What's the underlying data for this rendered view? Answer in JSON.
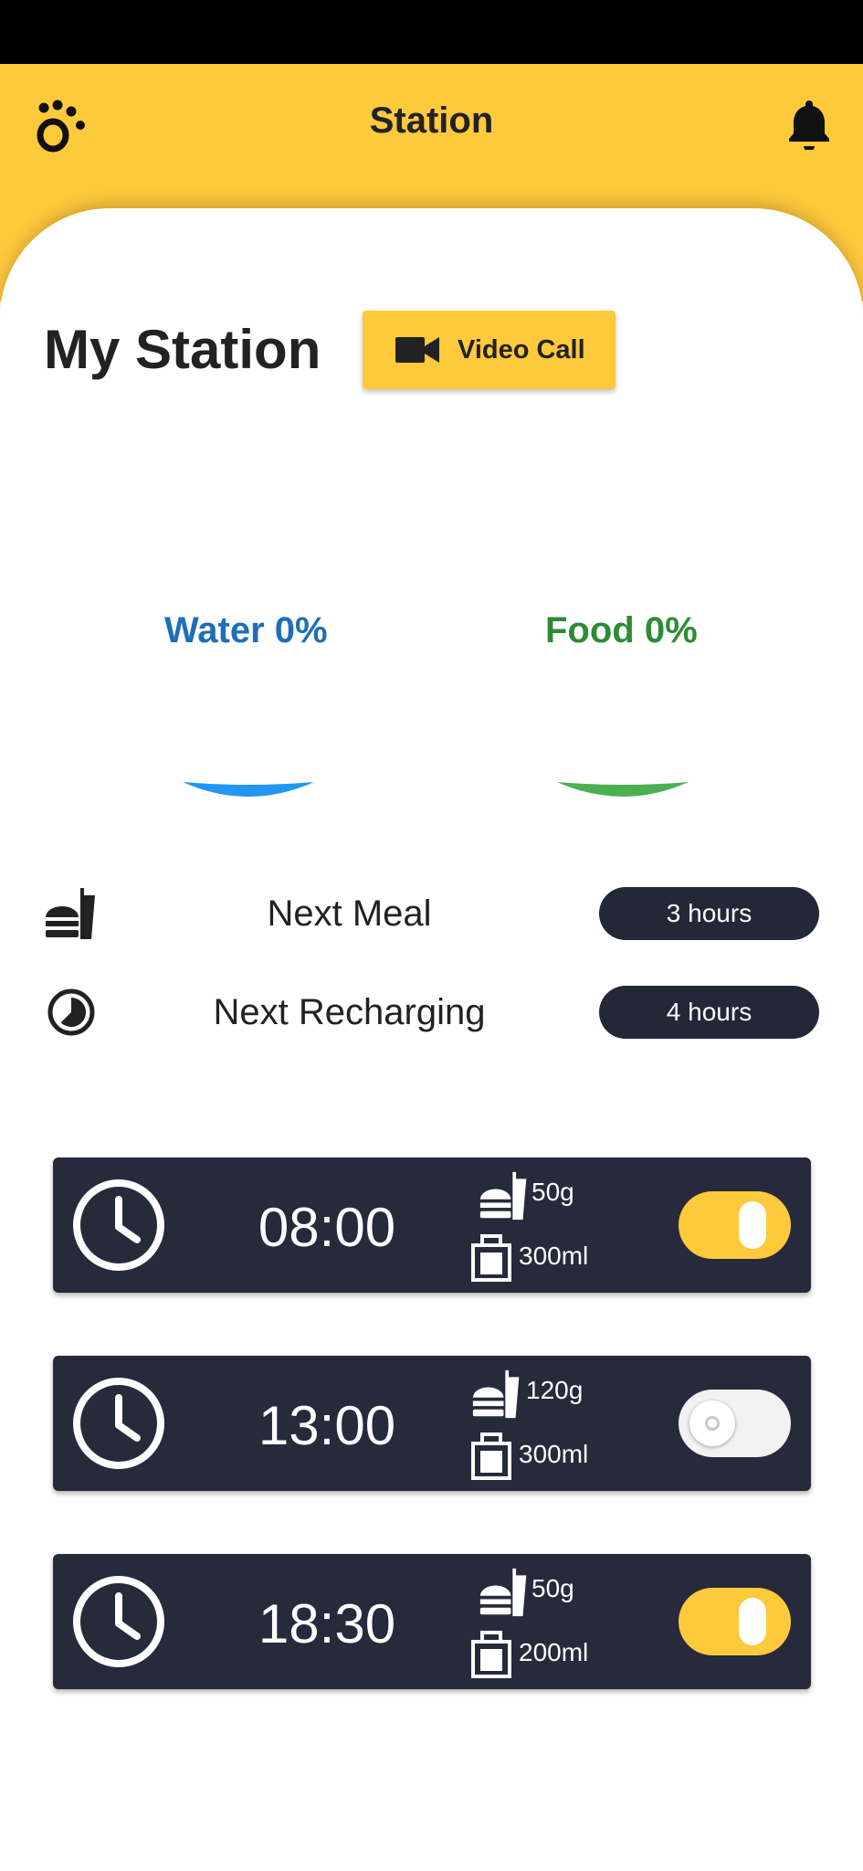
{
  "app_bar": {
    "title": "Station",
    "logo_icon": "paw-icon",
    "notification_icon": "bell-icon"
  },
  "station": {
    "title": "My Station",
    "video_call": {
      "label": "Video Call",
      "icon": "video-camera-icon"
    }
  },
  "levels": {
    "water": {
      "label": "Water 0%",
      "percent": 0,
      "color": "#2196F3"
    },
    "food": {
      "label": "Food 0%",
      "percent": 0,
      "color": "#4CAF50"
    }
  },
  "info": {
    "next_meal": {
      "label": "Next Meal",
      "value": "3 hours",
      "icon": "fastfood-icon"
    },
    "next_recharging": {
      "label": "Next Recharging",
      "value": "4 hours",
      "icon": "timelapse-icon"
    }
  },
  "schedules": [
    {
      "time": "08:00",
      "food": "50g",
      "water": "300ml",
      "enabled": true
    },
    {
      "time": "13:00",
      "food": "120g",
      "water": "300ml",
      "enabled": false
    },
    {
      "time": "18:30",
      "food": "50g",
      "water": "200ml",
      "enabled": true
    }
  ],
  "colors": {
    "accent": "#FFC93C",
    "card": "#262A3B",
    "water": "#1E6FB8",
    "food": "#2E8B35"
  }
}
